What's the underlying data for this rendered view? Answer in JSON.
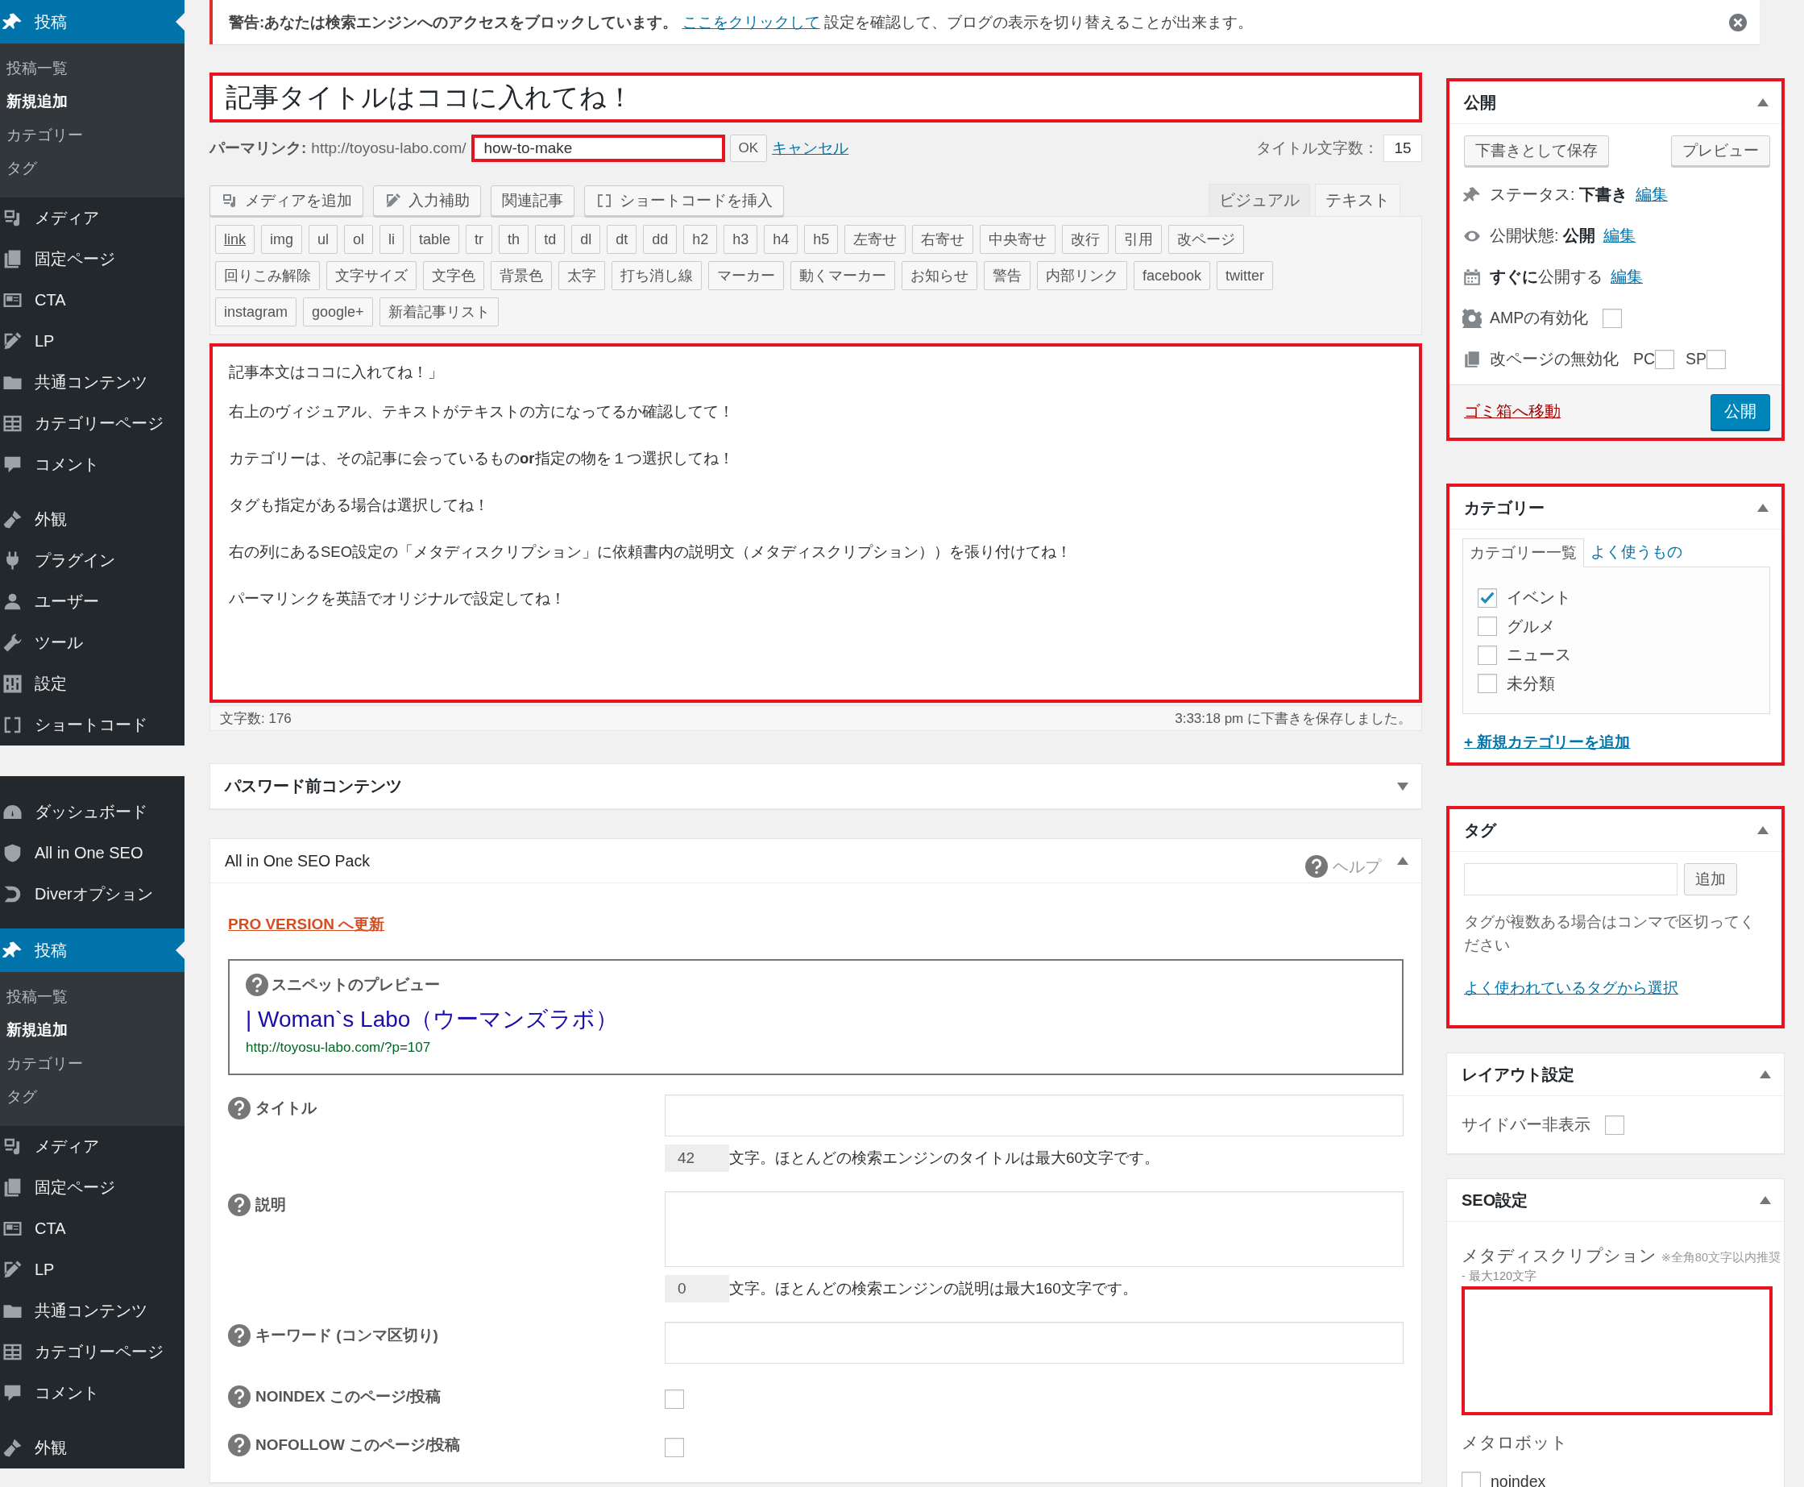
{
  "sidebars": [
    {
      "groups": [
        [
          {
            "label": "投稿",
            "selected": true,
            "children": [
              {
                "label": "投稿一覧",
                "selected": false
              },
              {
                "label": "新規追加",
                "selected": true
              },
              {
                "label": "カテゴリー",
                "selected": false
              },
              {
                "label": "タグ",
                "selected": false
              }
            ]
          },
          {
            "label": "メディア",
            "selected": false
          },
          {
            "label": "固定ページ",
            "selected": false
          },
          {
            "label": "CTA",
            "selected": false
          },
          {
            "label": "LP",
            "selected": false
          },
          {
            "label": "共通コンテンツ",
            "selected": false
          },
          {
            "label": "カテゴリーページ",
            "selected": false
          },
          {
            "label": "コメント",
            "selected": false
          }
        ],
        [
          {
            "label": "外観",
            "selected": false
          },
          {
            "label": "プラグイン",
            "selected": false
          },
          {
            "label": "ユーザー",
            "selected": false
          },
          {
            "label": "ツール",
            "selected": false
          },
          {
            "label": "設定",
            "selected": false
          },
          {
            "label": "ショートコード",
            "selected": false
          }
        ]
      ]
    },
    {
      "groups": [
        [
          {
            "label": "ダッシュボード",
            "selected": false
          },
          {
            "label": "All in One SEO",
            "selected": false
          },
          {
            "label": "Diverオプション",
            "selected": false
          }
        ],
        [
          {
            "label": "投稿",
            "selected": true,
            "children": [
              {
                "label": "投稿一覧",
                "selected": false
              },
              {
                "label": "新規追加",
                "selected": true
              },
              {
                "label": "カテゴリー",
                "selected": false
              },
              {
                "label": "タグ",
                "selected": false
              }
            ]
          },
          {
            "label": "メディア",
            "selected": false
          },
          {
            "label": "固定ページ",
            "selected": false
          },
          {
            "label": "CTA",
            "selected": false
          },
          {
            "label": "LP",
            "selected": false
          },
          {
            "label": "共通コンテンツ",
            "selected": false
          },
          {
            "label": "カテゴリーページ",
            "selected": false
          },
          {
            "label": "コメント",
            "selected": false
          }
        ],
        [
          {
            "label": "外観",
            "selected": false
          }
        ]
      ]
    }
  ],
  "notice": {
    "text": "**警告:あなたは検索エンジンへのアクセスをブロックしています。**",
    "link": "ここをクリックして",
    "after": "設定を確認して、ブログの表示を切り替えることが出来ます。"
  },
  "editor": {
    "title": {
      "value": "記事タイトルはココに入れてね！",
      "highlighted": true
    },
    "permalink": {
      "label": "パーマリンク:",
      "base": "http://toyosu-labo.com/",
      "slug": "how-to-make",
      "slug_highlighted": true,
      "ok": "OK",
      "cancel": "キャンセル"
    },
    "title_count": {
      "label": "タイトル文字数：",
      "value": "15"
    },
    "media_buttons": [
      "メディアを追加",
      "入力補助",
      "関連記事",
      "ショートコードを挿入"
    ],
    "tabs": [
      {
        "label": "ビジュアル",
        "selected": false
      },
      {
        "label": "テキスト",
        "selected": true
      }
    ],
    "quicktags": [
      [
        "link",
        "img",
        "ul",
        "ol",
        "li",
        "table",
        "tr",
        "th",
        "td",
        "dl",
        "dt",
        "dd",
        "h2",
        "h3",
        "h4",
        "h5",
        "左寄せ",
        "右寄せ",
        "中央寄せ",
        "改行",
        "引用",
        "改ページ"
      ],
      [
        "回りこみ解除",
        "文字サイズ",
        "文字色",
        "背景色",
        "太字",
        "打ち消し線",
        "マーカー",
        "動くマーカー",
        "お知らせ",
        "警告",
        "内部リンク",
        "facebook",
        "twitter"
      ],
      [
        "instagram",
        "google+",
        "新着記事リスト"
      ]
    ],
    "body": {
      "highlighted": true,
      "lines": [
        "記事本文はココに入れてね！」",
        "右上のヴィジュアル、テキストがテキストの方になってるか確認してて！",
        "カテゴリーは、その記事に会っているもの**or**指定の物を１つ選択してね！",
        "タグも指定がある場合は選択してね！",
        "右の列にあるSEO設定の「メタディスクリプション」に依頼書内の説明文（メタディスクリプション））を張り付けてね！",
        "パーマリンクを英語でオリジナルで設定してね！"
      ]
    },
    "word_count": "文字数: 176",
    "autosave": "3:33:18 pm に下書きを保存しました。"
  },
  "password_box": {
    "title": "パスワード前コンテンツ",
    "expanded": false
  },
  "seo_pack": {
    "title": "All in One SEO Pack",
    "help": "ヘルプ",
    "expanded": true,
    "pro_link": "PRO VERSION へ更新",
    "snippet": {
      "label": "スニペットのプレビュー",
      "title": "| Woman`s Labo（ウーマンズラボ）",
      "url": "http://toyosu-labo.com/?p=107"
    },
    "fields": [
      {
        "kind": "text",
        "label": "タイトル",
        "count": "42",
        "note": "文字。ほとんどの検索エンジンのタイトルは最大60文字です。"
      },
      {
        "kind": "textarea",
        "label": "説明",
        "count": "0",
        "note": "文字。ほとんどの検索エンジンの説明は最大160文字です。"
      },
      {
        "kind": "text",
        "label": "キーワード (コンマ区切り)"
      },
      {
        "kind": "checkbox",
        "label": "NOINDEX このページ/投稿",
        "checked": false
      },
      {
        "kind": "checkbox",
        "label": "NOFOLLOW このページ/投稿",
        "checked": false
      }
    ]
  },
  "publish": {
    "title": "公開",
    "expanded": true,
    "highlighted": true,
    "save_draft": "下書きとして保存",
    "preview": "プレビュー",
    "rows": [
      {
        "kind": "status",
        "text": "ステータス: **下書き**",
        "link": "編集"
      },
      {
        "kind": "visibility",
        "text": "公開状態: **公開**",
        "link": "編集"
      },
      {
        "kind": "schedule",
        "text": "**すぐに**公開する",
        "link": "編集"
      },
      {
        "kind": "amp",
        "text": "AMPの有効化",
        "checks": [
          {
            "checked": false
          }
        ]
      },
      {
        "kind": "paging",
        "text": "改ページの無効化",
        "checks": [
          {
            "label": "PC",
            "checked": false
          },
          {
            "label": "SP",
            "checked": false
          }
        ]
      }
    ],
    "trash": "ゴミ箱へ移動",
    "publish_button": "公開"
  },
  "categories": {
    "title": "カテゴリー",
    "expanded": true,
    "highlighted": true,
    "tabs": [
      {
        "label": "カテゴリー一覧",
        "selected": true
      },
      {
        "label": "よく使うもの",
        "selected": false
      }
    ],
    "items": [
      {
        "label": "イベント",
        "checked": true
      },
      {
        "label": "グルメ",
        "checked": false
      },
      {
        "label": "ニュース",
        "checked": false
      },
      {
        "label": "未分類",
        "checked": false
      }
    ],
    "add_link": "+ 新規カテゴリーを追加"
  },
  "tags": {
    "title": "タグ",
    "expanded": true,
    "highlighted": true,
    "add_button": "追加",
    "help": "タグが複数ある場合はコンマで区切ってください",
    "choose_link": "よく使われているタグから選択"
  },
  "layout": {
    "title": "レイアウト設定",
    "expanded": true,
    "option": {
      "label": "サイドバー非表示",
      "checked": false
    }
  },
  "seo": {
    "title": "SEO設定",
    "expanded": true,
    "meta_label": "メタディスクリプション",
    "meta_note": "※全角80文字以内推奨",
    "meta_note2": "- 最大120文字",
    "meta_highlighted": true,
    "robots_label": "メタロボット",
    "robots": [
      {
        "label": "noindex",
        "checked": false
      }
    ]
  }
}
